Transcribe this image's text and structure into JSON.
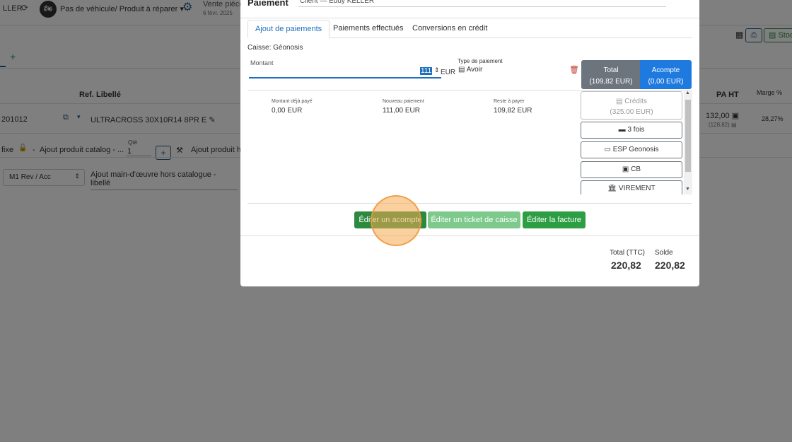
{
  "background_app": {
    "client_partial": "LLER",
    "vehicle_label": "Pas de véhicule/ Produit à réparer",
    "sale_label": "Vente pièce",
    "sale_date": "6 févr. 2025",
    "stock_label": "Stoc",
    "columns": {
      "ref": "Ref.",
      "libelle": "Libellé",
      "pa_ht": "PA HT",
      "marge": "Marge %"
    },
    "row1": {
      "code": "201012",
      "libelle": "ULTRACROSS 30X10R14 8PR E",
      "pa_ht": "132,00",
      "pa_sub": "(128,82)",
      "marge": "28,27%"
    },
    "row2": {
      "fixe": "fixe",
      "dash": "-",
      "catalog": "Ajout produit catalog - ...",
      "qte_label": "Qté",
      "qte_value": "1",
      "add": "+",
      "ajout_h": "Ajout produit h"
    },
    "row3": {
      "select_value": "M1 Rev / Acc",
      "mo_placeholder": "Ajout main-d'œuvre hors catalogue - libellé"
    },
    "plus": "+"
  },
  "modal": {
    "title": "Paiement",
    "client": "Client — Eddy KELLER",
    "tabs": [
      "Ajout de paiements",
      "Paiements effectués",
      "Conversions en crédit"
    ],
    "caisse": "Caisse: Géonosis",
    "montant_label": "Montant",
    "montant_value": "111",
    "currency": "EUR",
    "type_label": "Type de paiement",
    "type_value": "Avoir",
    "total": {
      "label": "Total",
      "value": "(109,82 EUR)"
    },
    "acompte": {
      "label": "Acompte",
      "value": "(0,00 EUR)"
    },
    "summary": {
      "deja_paye_label": "Montant déjà payé",
      "deja_paye": "0,00 EUR",
      "nouveau_label": "Nouveau paiement",
      "nouveau": "111,00 EUR",
      "reste_label": "Reste à payer",
      "reste": "109,82 EUR"
    },
    "payment_methods": [
      {
        "label": "Crédits",
        "sub": "(325.00 EUR)"
      },
      {
        "label": "3 fois"
      },
      {
        "label": "ESP Geonosis"
      },
      {
        "label": "CB"
      },
      {
        "label": "VIREMENT"
      }
    ],
    "buttons": {
      "acompte": "Éditer un acompte",
      "ticket": "Éditer un ticket de caisse",
      "facture": "Éditer la facture"
    },
    "footer": {
      "total_ttc_label": "Total (TTC)",
      "total_ttc": "220,82",
      "solde_label": "Solde",
      "solde": "220,82"
    }
  },
  "colors": {
    "primary": "#1f7ae0",
    "success": "#2b8a3e",
    "secondary": "#6c757d",
    "danger": "#c0392b",
    "click_highlight": "#f5aa50"
  }
}
